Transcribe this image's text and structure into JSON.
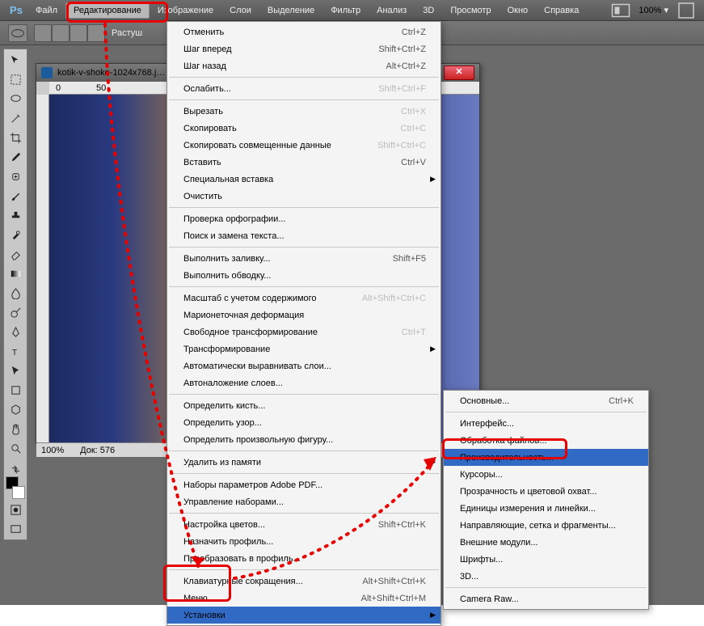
{
  "menubar": {
    "logo": "Ps",
    "items": [
      "Файл",
      "Редактирование",
      "Изображение",
      "Слои",
      "Выделение",
      "Фильтр",
      "Анализ",
      "3D",
      "Просмотр",
      "Окно",
      "Справка"
    ],
    "active_index": 1,
    "zoom": "100%"
  },
  "optionsbar": {
    "label": "Растуш"
  },
  "document": {
    "title": "kotik-v-shoke-1024x768.j…",
    "ruler": [
      "0",
      "50"
    ],
    "status_zoom": "100%",
    "status_doc": "Док: 576"
  },
  "menu_edit": [
    {
      "lbl": "Отменить",
      "sc": "Ctrl+Z"
    },
    {
      "lbl": "Шаг вперед",
      "sc": "Shift+Ctrl+Z"
    },
    {
      "lbl": "Шаг назад",
      "sc": "Alt+Ctrl+Z"
    },
    {
      "sep": true
    },
    {
      "lbl": "Ослабить...",
      "sc": "Shift+Ctrl+F",
      "disabled": true
    },
    {
      "sep": true
    },
    {
      "lbl": "Вырезать",
      "sc": "Ctrl+X",
      "disabled": true
    },
    {
      "lbl": "Скопировать",
      "sc": "Ctrl+C",
      "disabled": true
    },
    {
      "lbl": "Скопировать совмещенные данные",
      "sc": "Shift+Ctrl+C",
      "disabled": true
    },
    {
      "lbl": "Вставить",
      "sc": "Ctrl+V"
    },
    {
      "lbl": "Специальная вставка",
      "sub": true
    },
    {
      "lbl": "Очистить",
      "disabled": true
    },
    {
      "sep": true
    },
    {
      "lbl": "Проверка орфографии...",
      "disabled": true
    },
    {
      "lbl": "Поиск и замена текста...",
      "disabled": true
    },
    {
      "sep": true
    },
    {
      "lbl": "Выполнить заливку...",
      "sc": "Shift+F5"
    },
    {
      "lbl": "Выполнить обводку...",
      "disabled": true
    },
    {
      "sep": true
    },
    {
      "lbl": "Масштаб с учетом содержимого",
      "sc": "Alt+Shift+Ctrl+C",
      "disabled": true
    },
    {
      "lbl": "Марионеточная деформация",
      "disabled": true
    },
    {
      "lbl": "Свободное трансформирование",
      "sc": "Ctrl+T",
      "disabled": true
    },
    {
      "lbl": "Трансформирование",
      "sub": true,
      "disabled": true
    },
    {
      "lbl": "Автоматически выравнивать слои...",
      "disabled": true
    },
    {
      "lbl": "Автоналожение слоев...",
      "disabled": true
    },
    {
      "sep": true
    },
    {
      "lbl": "Определить кисть...",
      "disabled": true
    },
    {
      "lbl": "Определить узор...",
      "disabled": true
    },
    {
      "lbl": "Определить произвольную фигуру...",
      "disabled": true
    },
    {
      "sep": true
    },
    {
      "lbl": "Удалить из памяти",
      "sub": true,
      "disabled": true
    },
    {
      "sep": true
    },
    {
      "lbl": "Наборы параметров Adobe PDF..."
    },
    {
      "lbl": "Управление наборами..."
    },
    {
      "sep": true
    },
    {
      "lbl": "Настройка цветов...",
      "sc": "Shift+Ctrl+K"
    },
    {
      "lbl": "Назначить профиль..."
    },
    {
      "lbl": "Преобразовать в профиль..."
    },
    {
      "sep": true
    },
    {
      "lbl": "Клавиатурные сокращения...",
      "sc": "Alt+Shift+Ctrl+K"
    },
    {
      "lbl": "Меню...",
      "sc": "Alt+Shift+Ctrl+M"
    },
    {
      "lbl": "Установки",
      "sub": true,
      "hl": true
    }
  ],
  "menu_prefs": [
    {
      "lbl": "Основные...",
      "sc": "Ctrl+K"
    },
    {
      "sep": true
    },
    {
      "lbl": "Интерфейс..."
    },
    {
      "lbl": "Обработка файлов..."
    },
    {
      "lbl": "Производительность...",
      "hl": true
    },
    {
      "lbl": "Курсоры..."
    },
    {
      "lbl": "Прозрачность и цветовой охват..."
    },
    {
      "lbl": "Единицы измерения и линейки..."
    },
    {
      "lbl": "Направляющие, сетка и фрагменты..."
    },
    {
      "lbl": "Внешние модули..."
    },
    {
      "lbl": "Шрифты..."
    },
    {
      "lbl": "3D..."
    },
    {
      "sep": true
    },
    {
      "lbl": "Camera Raw..."
    }
  ],
  "tools": [
    "move",
    "marquee",
    "lasso",
    "wand",
    "crop",
    "eyedropper",
    "heal",
    "brush",
    "stamp",
    "history",
    "eraser",
    "gradient",
    "blur",
    "dodge",
    "pen",
    "type",
    "path",
    "rect",
    "shape",
    "hand",
    "zoom",
    "swatch-a",
    "swatch-b",
    "fg",
    "bg",
    "mask",
    "screen"
  ]
}
